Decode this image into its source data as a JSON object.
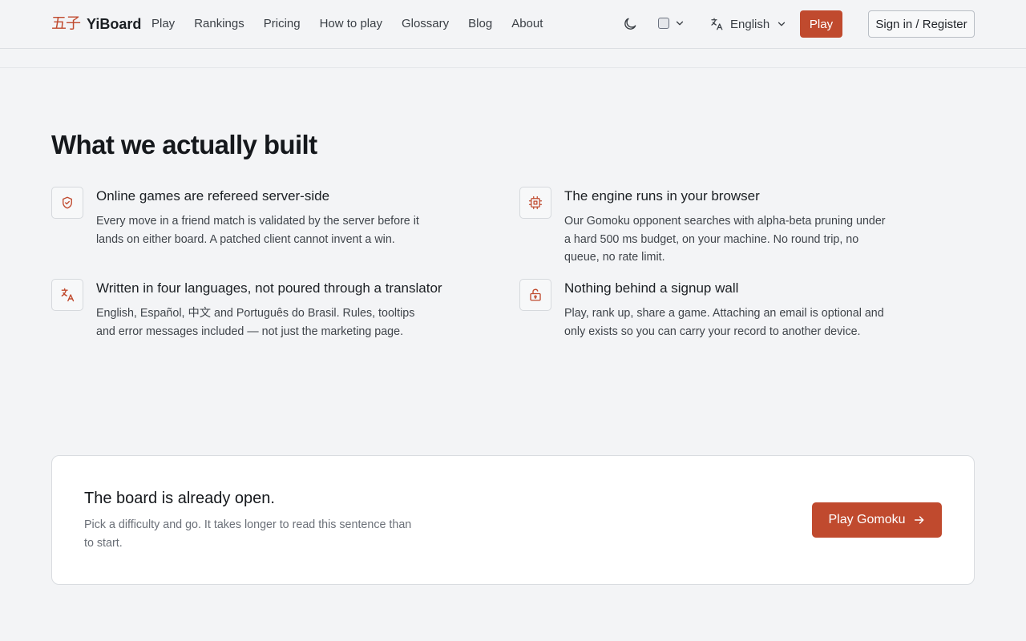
{
  "header": {
    "logo_mark": "五子",
    "logo_text": "YiBoard",
    "nav": [
      "Play",
      "Rankings",
      "Pricing",
      "How to play",
      "Glossary",
      "Blog",
      "About"
    ],
    "language": "English",
    "play_label": "Play",
    "signin_label": "Sign in / Register"
  },
  "icons": {
    "theme": "moon-icon",
    "mode": "square-icon",
    "language": "translate-icon",
    "chevron": "chevron-down-icon"
  },
  "section": {
    "title": "What we actually built",
    "features": [
      {
        "icon": "shield-check-icon",
        "title": "Online games are refereed server-side",
        "desc": "Every move in a friend match is validated by the server before it lands on either board. A patched client cannot invent a win."
      },
      {
        "icon": "cpu-icon",
        "title": "The engine runs in your browser",
        "desc": "Our Gomoku opponent searches with alpha-beta pruning under a hard 500 ms budget, on your machine. No round trip, no queue, no rate limit."
      },
      {
        "icon": "translate-icon",
        "title": "Written in four languages, not poured through a translator",
        "desc": "English, Español, 中文 and Português do Brasil. Rules, tooltips and error messages included — not just the marketing page."
      },
      {
        "icon": "unlock-icon",
        "title": "Nothing behind a signup wall",
        "desc": "Play, rank up, share a game. Attaching an email is optional and only exists so you can carry your record to another device."
      }
    ]
  },
  "cta": {
    "title": "The board is already open.",
    "desc": "Pick a difficulty and go. It takes longer to read this sentence than to start.",
    "button_label": "Play Gomoku",
    "button_icon": "arrow-right-icon"
  },
  "colors": {
    "accent": "#c04a2e",
    "background": "#f3f4f6",
    "card": "#ffffff"
  }
}
